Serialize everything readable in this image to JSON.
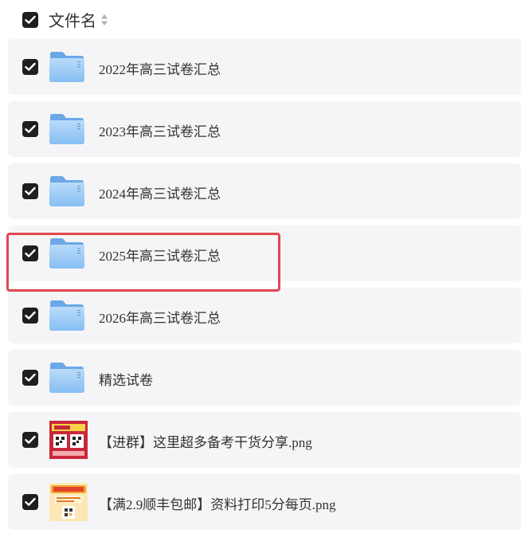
{
  "header": {
    "label": "文件名",
    "checked": true
  },
  "files": [
    {
      "name": "2022年高三试卷汇总",
      "type": "folder",
      "checked": true,
      "icon": "folder-icon"
    },
    {
      "name": "2023年高三试卷汇总",
      "type": "folder",
      "checked": true,
      "icon": "folder-icon"
    },
    {
      "name": "2024年高三试卷汇总",
      "type": "folder",
      "checked": true,
      "icon": "folder-icon"
    },
    {
      "name": "2025年高三试卷汇总",
      "type": "folder",
      "checked": true,
      "icon": "folder-icon",
      "highlighted": true
    },
    {
      "name": "2026年高三试卷汇总",
      "type": "folder",
      "checked": true,
      "icon": "folder-icon"
    },
    {
      "name": "精选试卷",
      "type": "folder",
      "checked": true,
      "icon": "folder-icon"
    },
    {
      "name": "【进群】这里超多备考干货分享.png",
      "type": "image",
      "checked": true,
      "icon": "image-thumbnail"
    },
    {
      "name": "【满2.9顺丰包邮】资料打印5分每页.png",
      "type": "image",
      "checked": true,
      "icon": "image-thumbnail"
    }
  ],
  "colors": {
    "row_bg": "#f5f5f7",
    "checkbox": "#1f1f1f",
    "folder": "#7db8f0",
    "highlight": "#e2474f"
  }
}
